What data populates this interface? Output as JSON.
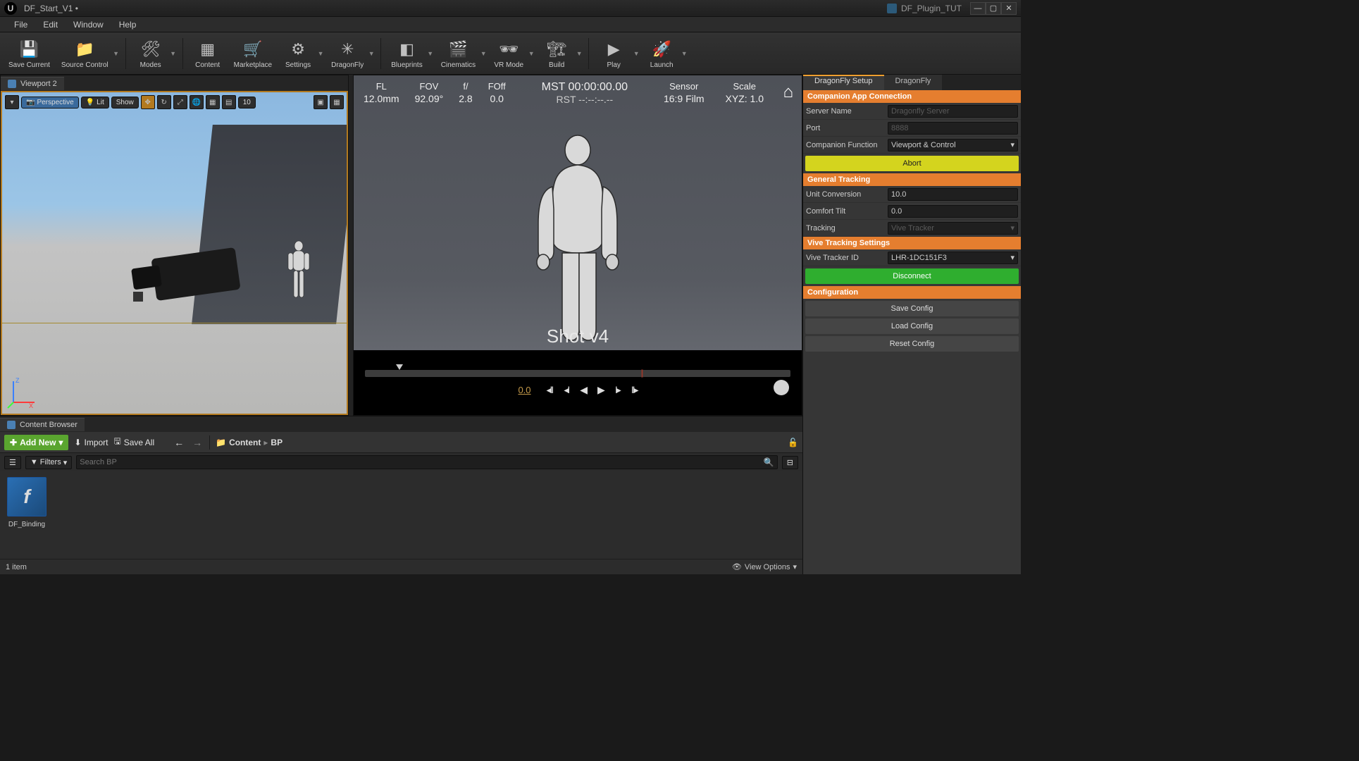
{
  "window": {
    "title": "DF_Start_V1 •",
    "project": "DF_Plugin_TUT"
  },
  "menu": [
    "File",
    "Edit",
    "Window",
    "Help"
  ],
  "toolbar": [
    {
      "label": "Save Current",
      "icon": "💾",
      "drop": false
    },
    {
      "label": "Source Control",
      "icon": "📁",
      "drop": true
    },
    {
      "sep": true
    },
    {
      "label": "Modes",
      "icon": "🛠",
      "drop": true
    },
    {
      "sep": true
    },
    {
      "label": "Content",
      "icon": "▦",
      "drop": false
    },
    {
      "label": "Marketplace",
      "icon": "🛒",
      "drop": false
    },
    {
      "label": "Settings",
      "icon": "⚙",
      "drop": true
    },
    {
      "label": "DragonFly",
      "icon": "✳",
      "drop": true
    },
    {
      "sep": true
    },
    {
      "label": "Blueprints",
      "icon": "◧",
      "drop": true
    },
    {
      "label": "Cinematics",
      "icon": "🎬",
      "drop": true
    },
    {
      "label": "VR Mode",
      "icon": "🕶",
      "drop": true
    },
    {
      "label": "Build",
      "icon": "🏗",
      "drop": true
    },
    {
      "sep": true
    },
    {
      "label": "Play",
      "icon": "▶",
      "drop": true
    },
    {
      "label": "Launch",
      "icon": "🚀",
      "drop": true
    }
  ],
  "viewport": {
    "tab": "Viewport 2",
    "perspective": "Perspective",
    "lit": "Lit",
    "show": "Show",
    "fps": "10"
  },
  "camera_view": {
    "cols": {
      "fl": {
        "lbl": "FL",
        "val": "12.0mm"
      },
      "fov": {
        "lbl": "FOV",
        "val": "92.09°"
      },
      "fstop": {
        "lbl": "f/",
        "val": "2.8"
      },
      "foff": {
        "lbl": "FOff",
        "val": "0.0"
      },
      "sensor": {
        "lbl": "Sensor",
        "val": "16:9 Film"
      },
      "scale": {
        "lbl": "Scale",
        "val": "XYZ: 1.0"
      }
    },
    "mst": "MST 00:00:00.00",
    "rst": "RST --:--:--.--",
    "shot": "Shot v4",
    "time": "0.0"
  },
  "content_browser": {
    "tab": "Content Browser",
    "add_new": "Add New",
    "import": "Import",
    "save_all": "Save All",
    "breadcrumb": [
      "Content",
      "BP"
    ],
    "filters": "Filters",
    "search_placeholder": "Search BP",
    "asset": "DF_Binding",
    "count": "1 item",
    "view_options": "View Options"
  },
  "right_panel": {
    "tabs": [
      "DragonFly Setup",
      "DragonFly"
    ],
    "sections": {
      "companion": {
        "title": "Companion App Connection",
        "server_name_lbl": "Server Name",
        "server_name_ph": "Dragonfly Server",
        "port_lbl": "Port",
        "port_ph": "8888",
        "cf_lbl": "Companion Function",
        "cf_val": "Viewport & Control",
        "abort": "Abort"
      },
      "tracking": {
        "title": "General Tracking",
        "unit_lbl": "Unit Conversion",
        "unit_val": "10.0",
        "tilt_lbl": "Comfort Tilt",
        "tilt_val": "0.0",
        "trk_lbl": "Tracking",
        "trk_val": "Vive Tracker"
      },
      "vive": {
        "title": "Vive Tracking Settings",
        "id_lbl": "Vive Tracker ID",
        "id_val": "LHR-1DC151F3",
        "disconnect": "Disconnect"
      },
      "config": {
        "title": "Configuration",
        "save": "Save Config",
        "load": "Load Config",
        "reset": "Reset Config"
      }
    }
  }
}
